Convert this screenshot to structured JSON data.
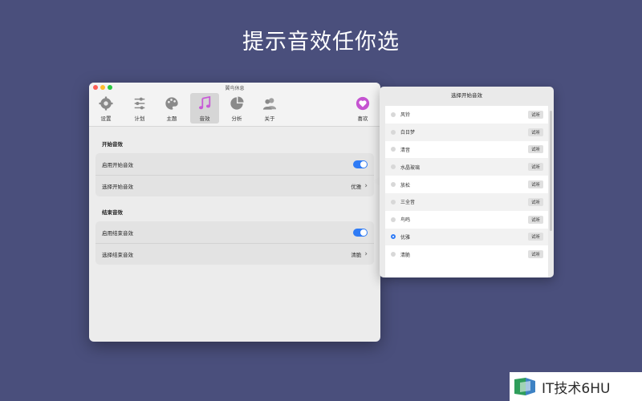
{
  "headline": "提示音效任你选",
  "window": {
    "title": "翼鸟休息",
    "toolbar": [
      {
        "label": "设置",
        "icon": "gear-icon"
      },
      {
        "label": "计划",
        "icon": "sliders-icon"
      },
      {
        "label": "主题",
        "icon": "palette-icon"
      },
      {
        "label": "音效",
        "icon": "music-note-icon",
        "active": true
      },
      {
        "label": "分析",
        "icon": "pie-chart-icon"
      },
      {
        "label": "关于",
        "icon": "people-icon"
      },
      {
        "label": "喜欢",
        "icon": "heart-badge-icon"
      }
    ],
    "start_section": {
      "title": "开始音效",
      "enable_label": "启用开始音效",
      "enable_on": true,
      "select_label": "选择开始音效",
      "select_value": "优雅"
    },
    "end_section": {
      "title": "结束音效",
      "enable_label": "启用结束音效",
      "enable_on": true,
      "select_label": "选择结束音效",
      "select_value": "清脆"
    }
  },
  "popover": {
    "title": "选择开始音效",
    "try_label": "试听",
    "items": [
      {
        "name": "风铃",
        "selected": false
      },
      {
        "name": "白日梦",
        "selected": false
      },
      {
        "name": "清音",
        "selected": false
      },
      {
        "name": "水晶玻璃",
        "selected": false
      },
      {
        "name": "放松",
        "selected": false
      },
      {
        "name": "三全音",
        "selected": false
      },
      {
        "name": "鸟鸣",
        "selected": false
      },
      {
        "name": "优雅",
        "selected": true
      },
      {
        "name": "清脆",
        "selected": false
      }
    ]
  },
  "watermark": {
    "text": "IT技术6HU"
  },
  "colors": {
    "background": "#4a4f7c",
    "accent": "#2f7bf5",
    "toggle": "#2f7bf5"
  }
}
